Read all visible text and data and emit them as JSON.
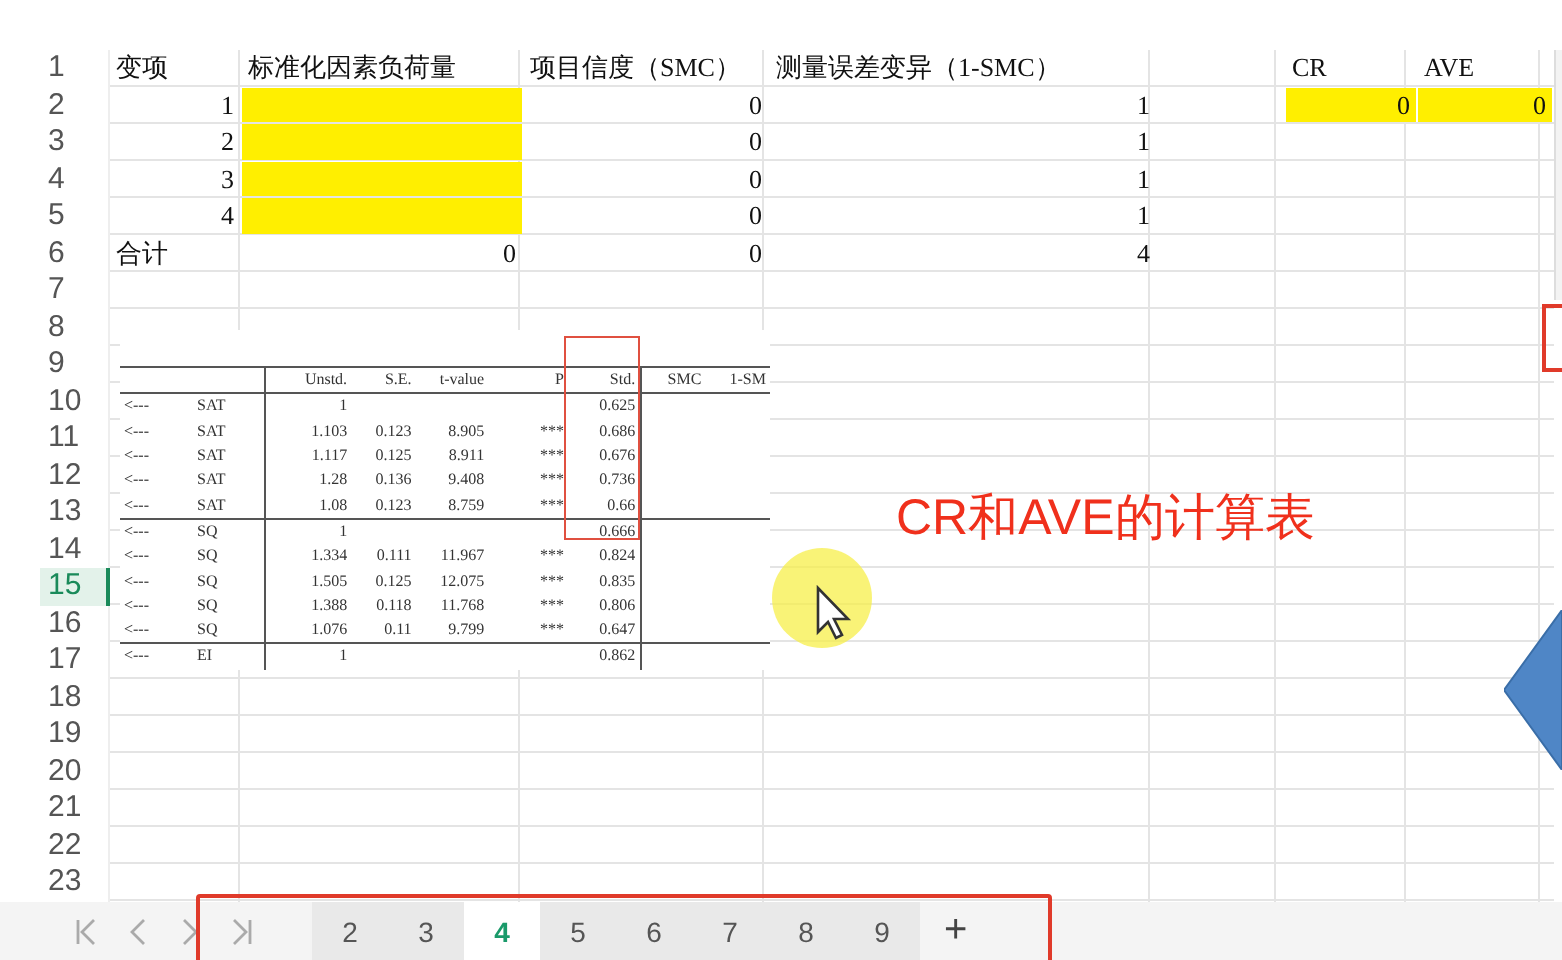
{
  "sheet": {
    "rows": [
      {
        "number": "1",
        "selected": false,
        "cells": [
          {
            "text": "变项",
            "kind": "text"
          },
          {
            "text": "标准化因素负荷量",
            "kind": "text"
          },
          {
            "text": "项目信度（SMC）",
            "kind": "text"
          },
          {
            "text": "测量误差变异（1-SMC）",
            "kind": "text"
          },
          {
            "highlighted": false
          },
          {
            "text": "CR",
            "kind": "text"
          },
          {
            "text": "AVE",
            "kind": "text"
          }
        ]
      },
      {
        "number": "2",
        "selected": false,
        "cells": [
          {
            "text": "1",
            "kind": "number"
          },
          {
            "highlighted": true
          },
          {
            "text": "0",
            "kind": "number"
          },
          {
            "text": "1",
            "kind": "number"
          },
          {
            "highlighted": false
          },
          {
            "text": "0",
            "kind": "number",
            "highlighted": true
          },
          {
            "text": "0",
            "kind": "number",
            "highlighted": true
          }
        ]
      },
      {
        "number": "3",
        "selected": false,
        "cells": [
          {
            "text": "2",
            "kind": "number"
          },
          {
            "highlighted": true
          },
          {
            "text": "0",
            "kind": "number"
          },
          {
            "text": "1",
            "kind": "number"
          }
        ]
      },
      {
        "number": "4",
        "selected": false,
        "cells": [
          {
            "text": "3",
            "kind": "number"
          },
          {
            "highlighted": true
          },
          {
            "text": "0",
            "kind": "number"
          },
          {
            "text": "1",
            "kind": "number"
          }
        ]
      },
      {
        "number": "5",
        "selected": false,
        "cells": [
          {
            "text": "4",
            "kind": "number"
          },
          {
            "highlighted": true
          },
          {
            "text": "0",
            "kind": "number"
          },
          {
            "text": "1",
            "kind": "number"
          }
        ]
      },
      {
        "number": "6",
        "selected": false,
        "cells": [
          {
            "text": "合计",
            "kind": "text"
          },
          {
            "text": "0",
            "kind": "number"
          },
          {
            "text": "0",
            "kind": "number"
          },
          {
            "text": "4",
            "kind": "number"
          }
        ]
      },
      {
        "number": "7",
        "selected": false,
        "cells": []
      },
      {
        "number": "8",
        "selected": false,
        "cells": []
      },
      {
        "number": "9",
        "selected": false,
        "cells": []
      },
      {
        "number": "10",
        "selected": false,
        "cells": []
      },
      {
        "number": "11",
        "selected": false,
        "cells": []
      },
      {
        "number": "12",
        "selected": false,
        "cells": []
      },
      {
        "number": "13",
        "selected": false,
        "cells": []
      },
      {
        "number": "14",
        "selected": false,
        "cells": []
      },
      {
        "number": "15",
        "selected": true,
        "cells": []
      },
      {
        "number": "16",
        "selected": false,
        "cells": []
      },
      {
        "number": "17",
        "selected": false,
        "cells": []
      },
      {
        "number": "18",
        "selected": false,
        "cells": []
      },
      {
        "number": "19",
        "selected": false,
        "cells": []
      },
      {
        "number": "20",
        "selected": false,
        "cells": []
      },
      {
        "number": "21",
        "selected": false,
        "cells": []
      },
      {
        "number": "22",
        "selected": false,
        "cells": []
      },
      {
        "number": "23",
        "selected": false,
        "cells": []
      }
    ]
  },
  "pasted_table": {
    "columns": [
      "",
      "",
      "Unstd.",
      "S.E.",
      "t-value",
      "P",
      "Std.",
      "SMC",
      "1-SM"
    ],
    "rows": [
      [
        "<---",
        "SAT",
        "1",
        "",
        "",
        "",
        "0.625"
      ],
      [
        "<---",
        "SAT",
        "1.103",
        "0.123",
        "8.905",
        "***",
        "0.686"
      ],
      [
        "<---",
        "SAT",
        "1.117",
        "0.125",
        "8.911",
        "***",
        "0.676"
      ],
      [
        "<---",
        "SAT",
        "1.28",
        "0.136",
        "9.408",
        "***",
        "0.736"
      ],
      [
        "<---",
        "SAT",
        "1.08",
        "0.123",
        "8.759",
        "***",
        "0.66"
      ],
      [
        "<---",
        "SQ",
        "1",
        "",
        "",
        "",
        "0.666"
      ],
      [
        "<---",
        "SQ",
        "1.334",
        "0.111",
        "11.967",
        "***",
        "0.824"
      ],
      [
        "<---",
        "SQ",
        "1.505",
        "0.125",
        "12.075",
        "***",
        "0.835"
      ],
      [
        "<---",
        "SQ",
        "1.388",
        "0.118",
        "11.768",
        "***",
        "0.806"
      ],
      [
        "<---",
        "SQ",
        "1.076",
        "0.11",
        "9.799",
        "***",
        "0.647"
      ],
      [
        "<---",
        "EI",
        "1",
        "",
        "",
        "",
        "0.862"
      ]
    ]
  },
  "caption": "CR和AVE的计算表",
  "sheet_tabs": [
    {
      "label": "2",
      "selected": false
    },
    {
      "label": "3",
      "selected": false
    },
    {
      "label": "4",
      "selected": true
    },
    {
      "label": "5",
      "selected": false
    },
    {
      "label": "6",
      "selected": false
    },
    {
      "label": "7",
      "selected": false
    },
    {
      "label": "8",
      "selected": false
    },
    {
      "label": "9",
      "selected": false
    }
  ],
  "add_tab": "+"
}
